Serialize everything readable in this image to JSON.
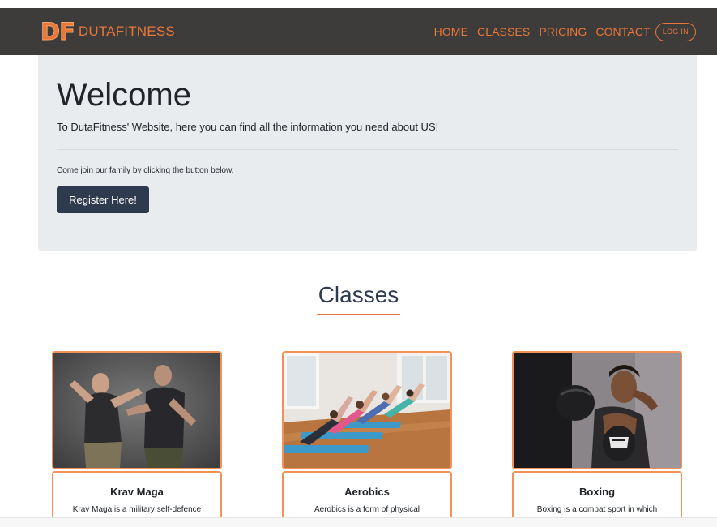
{
  "navbar": {
    "logo_text": "DF",
    "brand_name": "DUTAFITNESS",
    "links": [
      "HOME",
      "CLASSES",
      "PRICING",
      "CONTACT"
    ],
    "login_label": "LOG IN"
  },
  "jumbotron": {
    "title": "Welcome",
    "lead": "To DutaFitness' Website, here you can find all the information you need about US!",
    "small_text": "Come join our family by clicking the button below.",
    "button_label": "Register Here!"
  },
  "classes": {
    "heading": "Classes",
    "cards": [
      {
        "title": "Krav Maga",
        "text": "Krav Maga is a military self-defence",
        "image": "krav-maga-image"
      },
      {
        "title": "Aerobics",
        "text": "Aerobics is a form of physical",
        "image": "aerobics-image"
      },
      {
        "title": "Boxing",
        "text": "Boxing is a combat sport in which",
        "image": "boxing-image"
      }
    ]
  },
  "colors": {
    "accent": "#e8773a",
    "navbar_bg": "#3e3c3b",
    "jumbotron_bg": "#e9ecef",
    "button_bg": "#2e3b4e",
    "card_border": "#f39159"
  }
}
